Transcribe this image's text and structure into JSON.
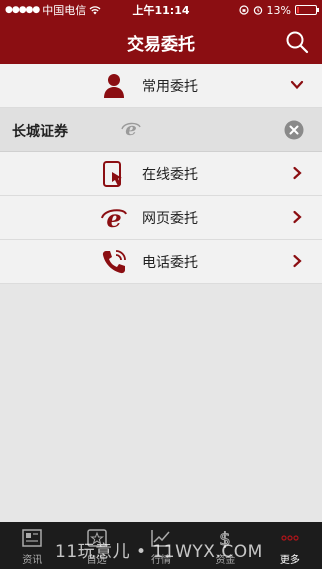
{
  "status_bar": {
    "carrier": "中国电信",
    "time": "上午11:14",
    "battery": "13%",
    "battery_level": 0.13
  },
  "nav": {
    "title": "交易委托",
    "search_icon": "search-icon"
  },
  "common": {
    "label": "常用委托",
    "icon": "user-icon",
    "arrow": "chevron-down-icon"
  },
  "broker": {
    "name": "长城证券",
    "icon": "ie-icon",
    "close_icon": "close-circle-icon"
  },
  "items": [
    {
      "label": "在线委托",
      "icon": "phone-touch-icon"
    },
    {
      "label": "网页委托",
      "icon": "ie-icon"
    },
    {
      "label": "电话委托",
      "icon": "phone-call-icon"
    }
  ],
  "tabbar": {
    "tabs": [
      {
        "label": "资讯",
        "icon": "news-icon"
      },
      {
        "label": "自选",
        "icon": "star-list-icon"
      },
      {
        "label": "行情",
        "icon": "chart-icon"
      },
      {
        "label": "资金",
        "icon": "dollar-icon"
      },
      {
        "label": "更多",
        "icon": "more-icon",
        "active": true
      }
    ]
  },
  "watermark": "11玩意儿 • 11WYX.COM",
  "colors": {
    "brand": "#8b0e12",
    "row_bg": "#f2f2f2",
    "tabbar_bg": "#1c1c1c"
  }
}
